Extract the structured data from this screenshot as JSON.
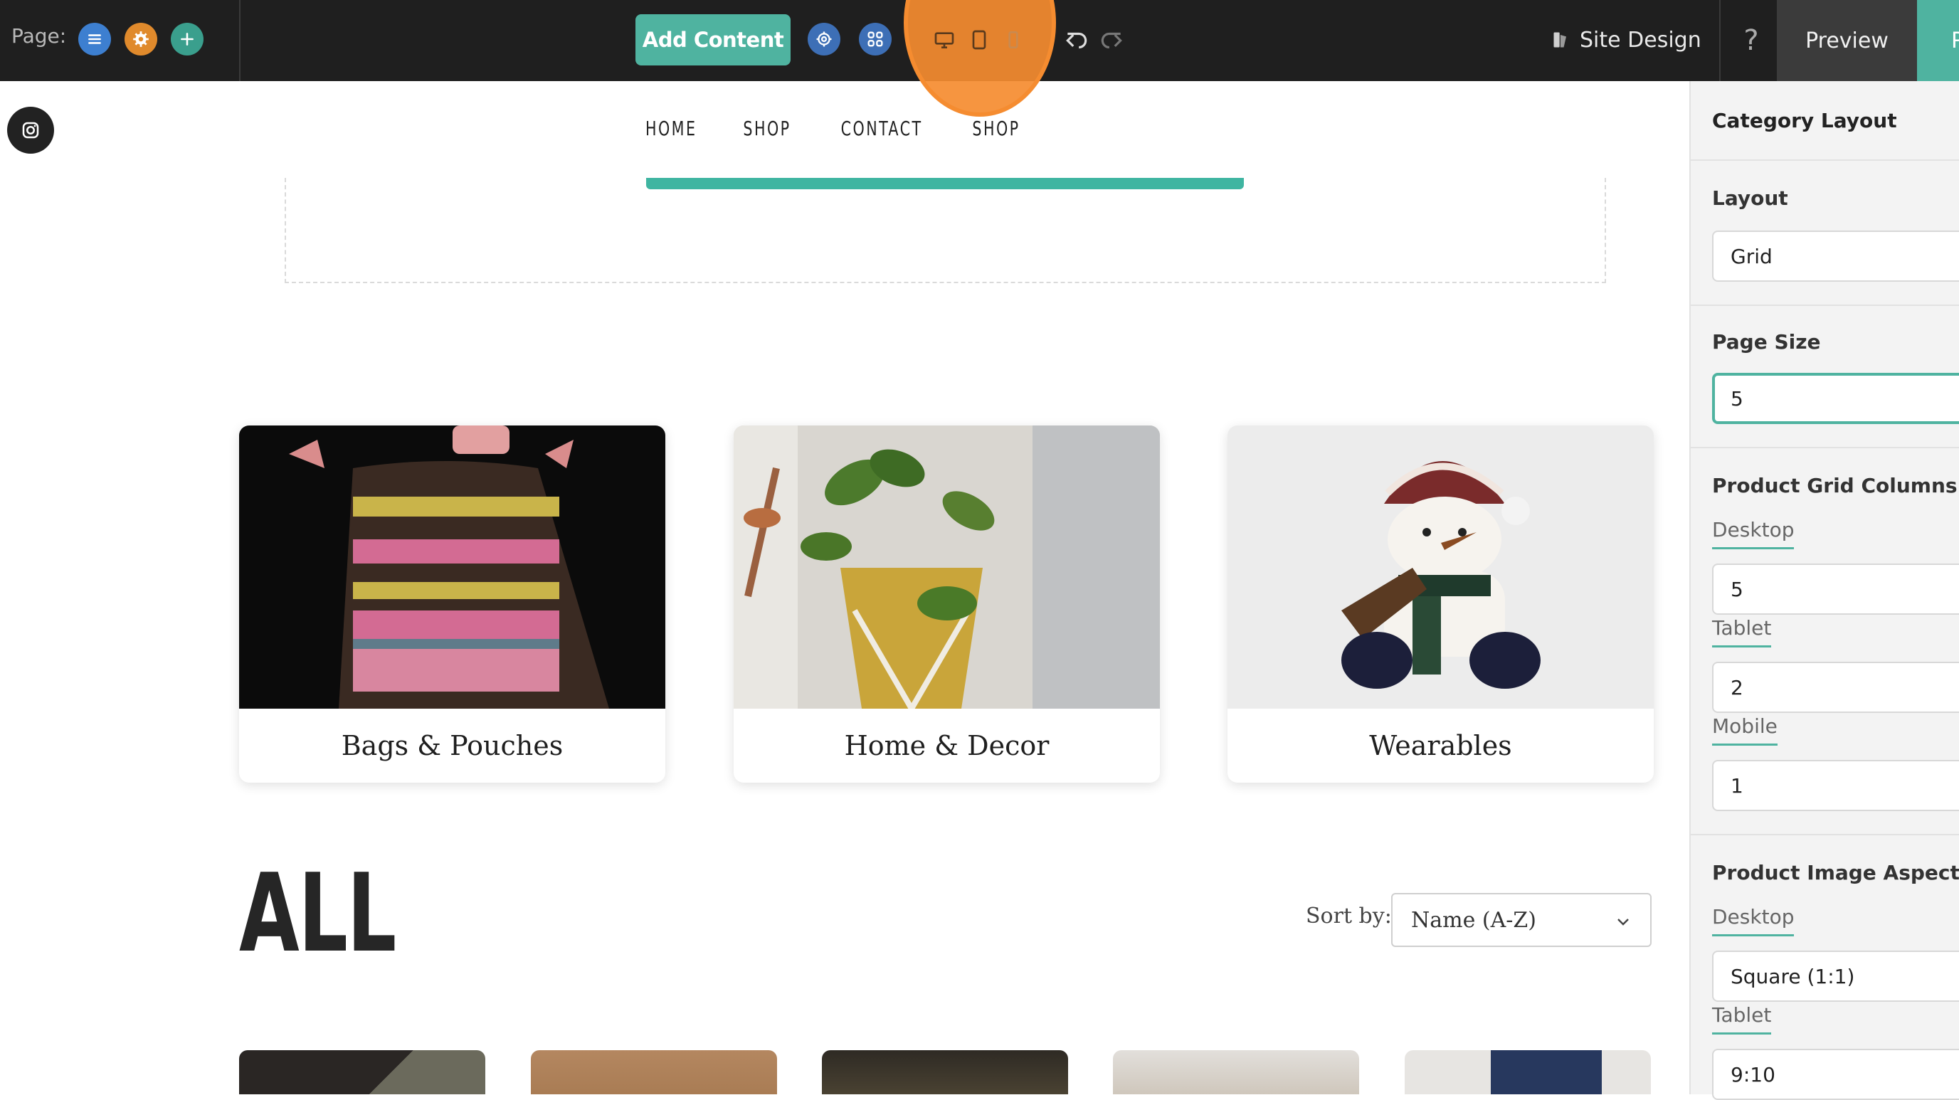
{
  "topbar": {
    "page_label": "Page:",
    "add_content": "Add Content",
    "site_design": "Site Design",
    "help": "?",
    "preview": "Preview",
    "publish": "P"
  },
  "nav": [
    "HOME",
    "SHOP",
    "CONTACT",
    "SHOP"
  ],
  "categories": [
    {
      "label": "Bags & Pouches"
    },
    {
      "label": "Home & Decor"
    },
    {
      "label": "Wearables"
    }
  ],
  "section": {
    "heading": "ALL",
    "sort_label": "Sort by:",
    "sort_value": "Name (A-Z)"
  },
  "panel": {
    "title": "Category Layout",
    "layout_title": "Layout",
    "layout_value": "Grid",
    "page_size_title": "Page Size",
    "page_size_value": "5",
    "grid_columns_title": "Product Grid Columns",
    "grid_desktop_label": "Desktop",
    "grid_desktop_value": "5",
    "grid_tablet_label": "Tablet",
    "grid_tablet_value": "2",
    "grid_mobile_label": "Mobile",
    "grid_mobile_value": "1",
    "aspect_title": "Product Image Aspect Ratio",
    "aspect_desktop_label": "Desktop",
    "aspect_desktop_value": "Square (1:1)",
    "aspect_tablet_label": "Tablet",
    "aspect_tablet_value": "9:10"
  },
  "colors": {
    "accent": "#4fb3a0",
    "highlight": "#f58c30",
    "toolbar": "#1f1f1f"
  }
}
